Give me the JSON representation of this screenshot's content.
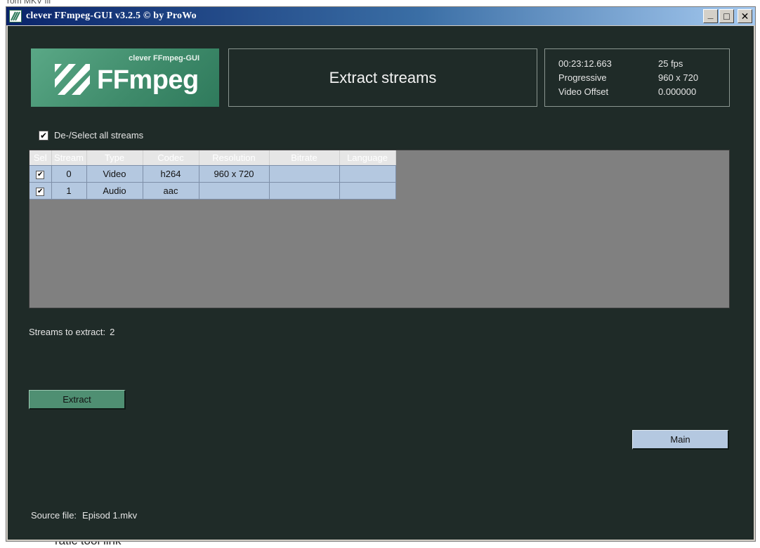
{
  "window": {
    "title": "clever FFmpeg-GUI v3.2.5   © by ProWo",
    "minimize": "_",
    "maximize": "□",
    "close": "✕"
  },
  "logo": {
    "subtitle": "clever FFmpeg-GUI",
    "wordmark": "FFmpeg"
  },
  "page_title": "Extract streams",
  "info": {
    "duration": "00:23:12.663",
    "fps": "25 fps",
    "scan": "Progressive",
    "resolution": "960 x 720",
    "offset_label": "Video Offset",
    "offset_value": "0.000000"
  },
  "select_all": {
    "label": "De-/Select all streams",
    "checked": true
  },
  "streams_table": {
    "headers": [
      "Sel",
      "Stream",
      "Type",
      "Codec",
      "Resolution",
      "Bitrate",
      "Language"
    ],
    "rows": [
      {
        "stream": "0",
        "type": "Video",
        "codec": "h264",
        "resolution": "960 x 720",
        "bitrate": "",
        "language": "",
        "selected": true
      },
      {
        "stream": "1",
        "type": "Audio",
        "codec": "aac",
        "resolution": "",
        "bitrate": "",
        "language": "",
        "selected": true
      }
    ]
  },
  "streams_to_extract": {
    "label": "Streams to extract:",
    "count": "2"
  },
  "buttons": {
    "extract": "Extract",
    "main": "Main"
  },
  "source": {
    "label": "Source file:",
    "value": "Episod 1.mkv"
  },
  "checkmark": "✔",
  "background_page": {
    "top_fragment": "rom MKV fil",
    "bottom_fragment": "ratic tool link"
  },
  "colors": {
    "client_bg": "#1f2b28",
    "logo_green": "#3e8a6a",
    "row_blue": "#b4c8e0",
    "extract_green": "#4f8f72"
  }
}
